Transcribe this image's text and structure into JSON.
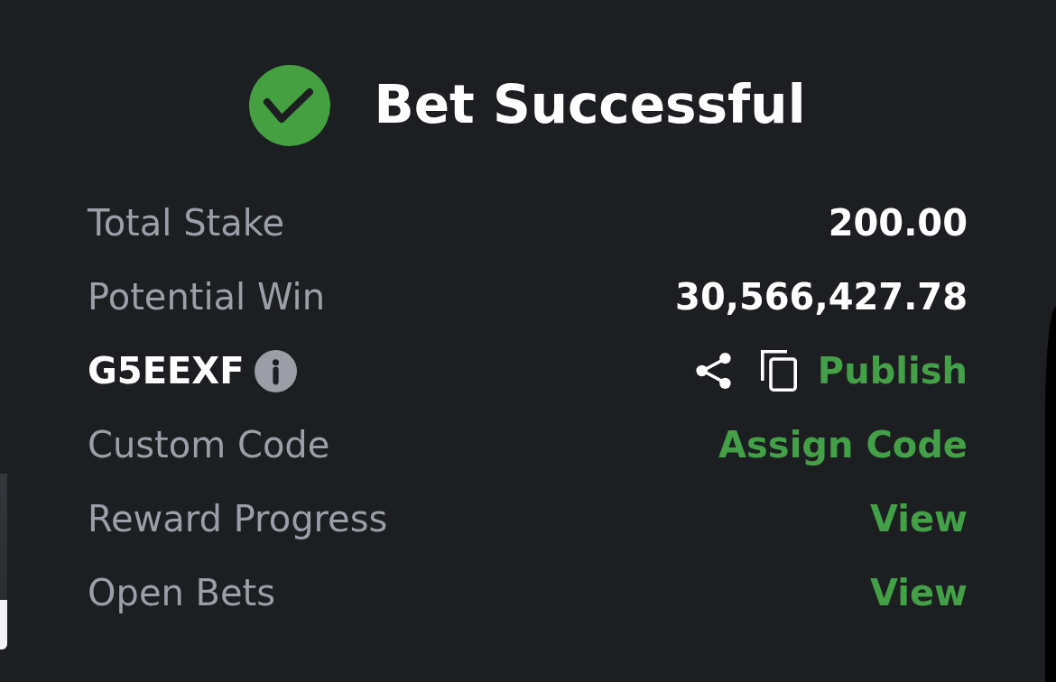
{
  "header": {
    "title": "Bet Successful"
  },
  "rows": [
    {
      "kind": "amount",
      "label": "Total Stake",
      "value": "200.00"
    },
    {
      "kind": "amount",
      "label": "Potential Win",
      "value": "30,566,427.78"
    },
    {
      "kind": "code",
      "code": "G5EEXF",
      "action": "Publish"
    },
    {
      "kind": "link",
      "label": "Custom Code",
      "action": "Assign Code"
    },
    {
      "kind": "link",
      "label": "Reward Progress",
      "action": "View"
    },
    {
      "kind": "link",
      "label": "Open Bets",
      "action": "View"
    }
  ]
}
